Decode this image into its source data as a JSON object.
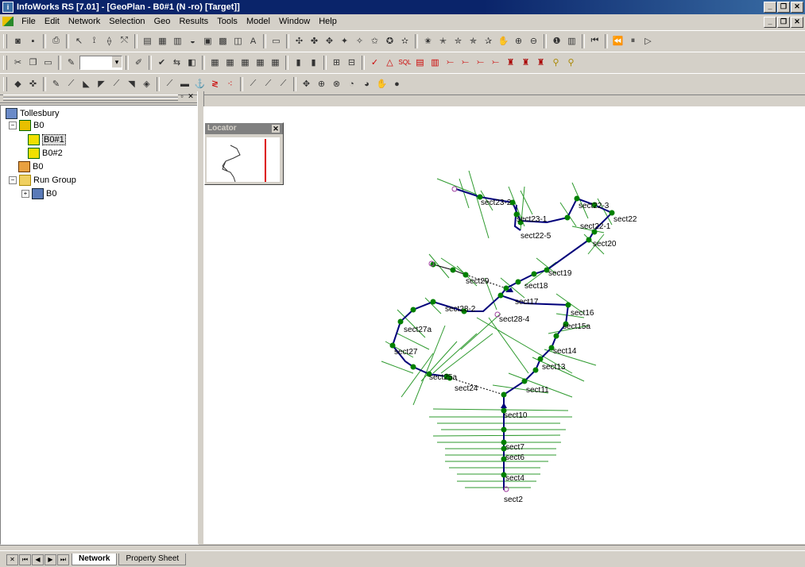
{
  "window": {
    "title": "InfoWorks RS [7.01] - [GeoPlan - B0#1 (N -ro) [Target]]"
  },
  "menu": [
    "File",
    "Edit",
    "Network",
    "Selection",
    "Geo",
    "Results",
    "Tools",
    "Model",
    "Window",
    "Help"
  ],
  "tree": {
    "root": "Tollesbury",
    "items": [
      {
        "label": "B0",
        "level": 1,
        "expander": "−"
      },
      {
        "label": "B0#1",
        "level": 2,
        "selected": true
      },
      {
        "label": "B0#2",
        "level": 2
      },
      {
        "label": "B0",
        "level": 1
      },
      {
        "label": "Run Group",
        "level": 1,
        "expander": "−"
      },
      {
        "label": "B0",
        "level": 2,
        "expander": "+"
      }
    ]
  },
  "locator": {
    "title": "Locator"
  },
  "tabs": {
    "network": "Network",
    "property_sheet": "Property Sheet"
  },
  "map": {
    "labels": {
      "sect23_2": "sect23-2",
      "sect23_1": "sect23-1",
      "sect22_5": "sect22-5",
      "sect22_3": "sect22-3",
      "sect22": "sect22",
      "sect22_1": "sect22-1",
      "sect20": "sect20",
      "sect19": "sect19",
      "sect29": "sect29",
      "sect18": "sect18",
      "sect17": "sect17",
      "sect16": "sect16",
      "sect28_2": "sect28-2",
      "sect28_4": "sect28-4",
      "sect15a": "sect15a",
      "sect27a": "sect27a",
      "sect14": "sect14",
      "sect27": "sect27",
      "sect13": "sect13",
      "sect25a": "sect25a",
      "sect24": "sect24",
      "sect11": "sect11",
      "sect10": "sect10",
      "sect7": "sect7",
      "sect6": "sect6",
      "sect4": "sect4",
      "sect2": "sect2"
    },
    "colors": {
      "reach": "#00007a",
      "section": "#2e9a2e",
      "node": "#008000"
    }
  }
}
